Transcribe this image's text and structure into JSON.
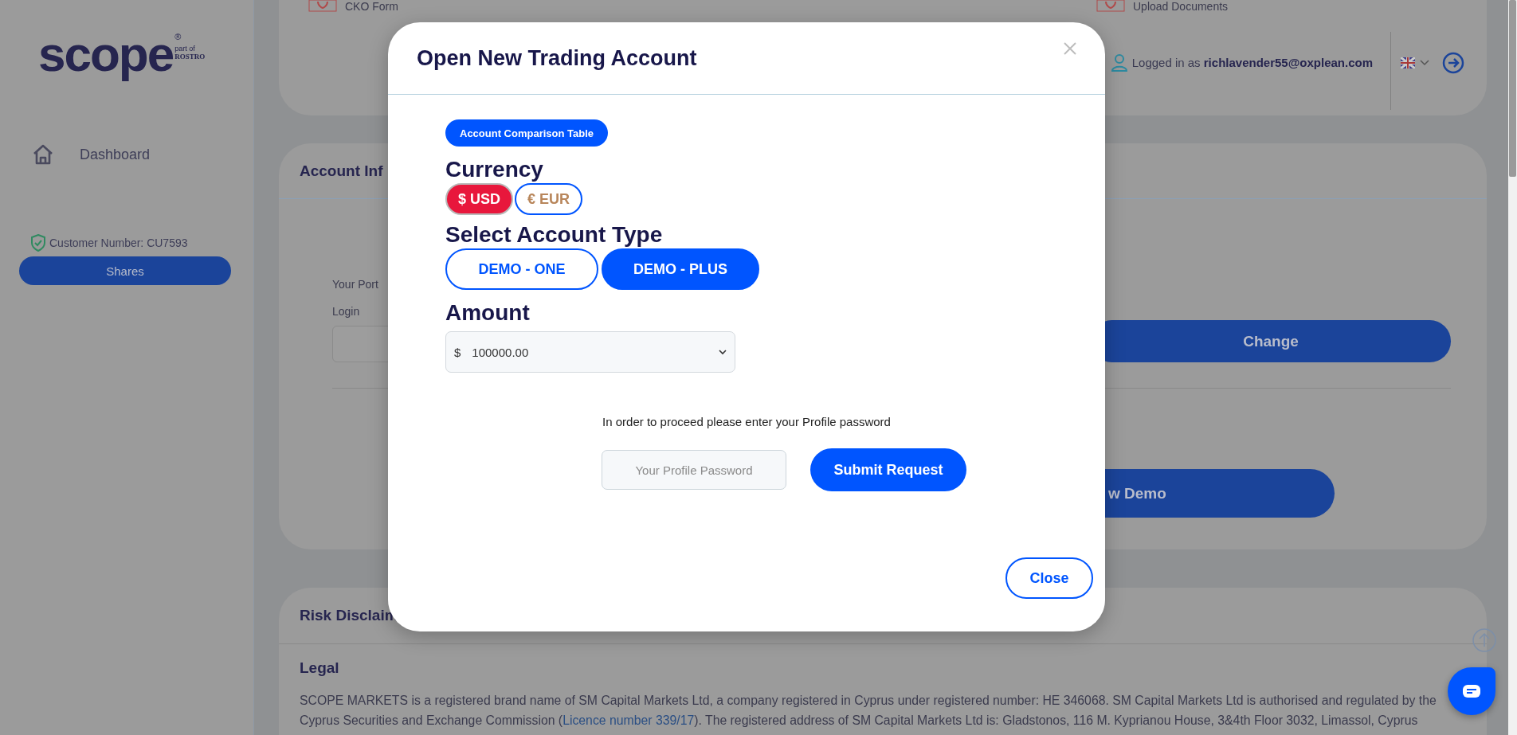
{
  "sidebar": {
    "logo": {
      "name": "scope",
      "mark": "®",
      "tagline": "part of",
      "parent": "ROSTRO"
    },
    "nav": [
      {
        "label": "Dashboard"
      }
    ],
    "customer_number": "Customer Number: CU7593",
    "account_button": "Shares"
  },
  "top_card": {
    "links": [
      {
        "label": "CKO Form"
      },
      {
        "label": "Upload Documents"
      }
    ],
    "user": "Logged in as **richlavender55@oxplean.com**"
  },
  "account_card": {
    "title": "Account Inf",
    "portfolio_label": "Your Port",
    "login_label": "Login",
    "change_button": "Change",
    "demo_button": "w Demo"
  },
  "disclaimer_card": {
    "title": "Risk Disclaim",
    "legal_heading": "Legal",
    "legal_before": "SCOPE MARKETS is a registered brand name of SM Capital Markets Ltd, a company registered in Cyprus under registered number: HE 346068. SM Capital Markets Ltd is authorised and regulated by the Cyprus Securities and Exchange Commission (",
    "legal_link": "Licence number 339/17",
    "legal_after": "). The registered address of SM Capital Markets Ltd is: Gladstonos, 116 M. Kyprianou House, 3&4th Floor 3032, Limassol, Cyprus"
  },
  "modal": {
    "title": "Open New Trading Account",
    "comparison_button": "Account Comparison Table",
    "currency_label": "Currency",
    "currencies": [
      {
        "label": "$ USD",
        "selected": true
      },
      {
        "label": "€ EUR",
        "selected": false
      }
    ],
    "type_label": "Select Account Type",
    "account_types": [
      {
        "label": "DEMO - ONE",
        "selected": false
      },
      {
        "label": "DEMO - PLUS",
        "selected": true
      }
    ],
    "amount_label": "Amount",
    "amount": {
      "prefix": "$",
      "value": "100000.00"
    },
    "prompt": "In order to proceed please enter your Profile password",
    "password": {
      "placeholder": "Your Profile Password"
    },
    "submit_button": "Submit Request",
    "close_button": "Close"
  }
}
